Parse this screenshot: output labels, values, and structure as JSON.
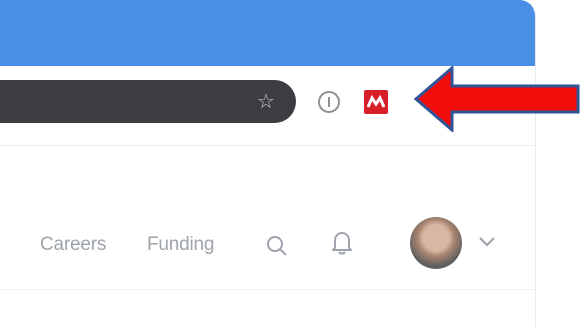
{
  "browser": {
    "titlebar_color": "#4a8fe6",
    "toolbar": {
      "bookmark_icon": "star-icon",
      "extensions": [
        {
          "name": "info-extension-icon",
          "color": "#8d9196"
        },
        {
          "name": "red-m-extension-icon",
          "color": "#d71f2a"
        }
      ]
    }
  },
  "site": {
    "nav": {
      "careers_label": "Careers",
      "funding_label": "Funding",
      "search_icon": "search-icon",
      "notifications_icon": "bell-icon",
      "profile_menu_icon": "chevron-down-icon"
    }
  },
  "annotation": {
    "pointer": "red-arrow",
    "color": "#f20d0d",
    "outline_color": "#2f5597"
  }
}
